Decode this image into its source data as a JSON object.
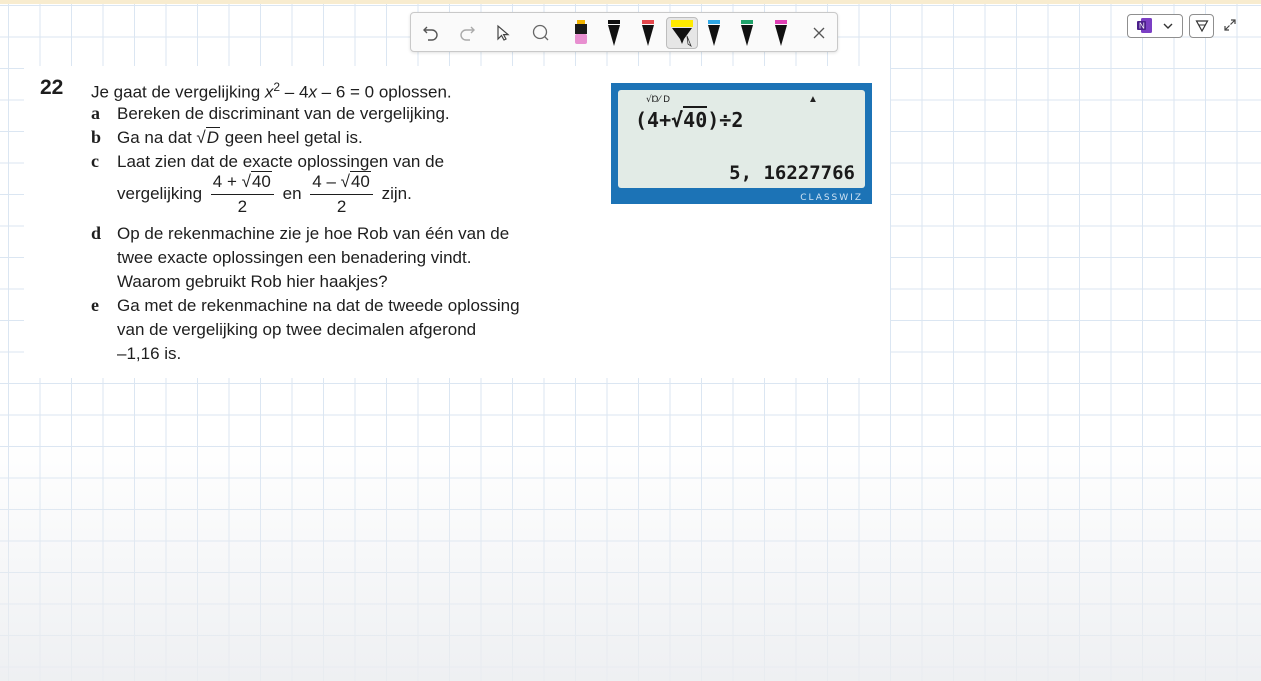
{
  "toolbar": {
    "undo_icon": "undo-icon",
    "redo_icon": "redo-icon",
    "select_icon": "pointer-icon",
    "lasso_icon": "lasso-icon",
    "pens": [
      {
        "name": "eraser-pen",
        "color": "#e88fd0"
      },
      {
        "name": "black-pen",
        "color": "#111111"
      },
      {
        "name": "red-pen",
        "color": "#e5484d"
      },
      {
        "name": "yellow-highlighter",
        "color": "#ffeb00"
      },
      {
        "name": "blue-pen",
        "color": "#2fa7e5"
      },
      {
        "name": "green-pen",
        "color": "#20a36b"
      },
      {
        "name": "magenta-pen",
        "color": "#e040b5"
      }
    ],
    "close_icon": "close-icon"
  },
  "controls": {
    "app_icon": "onenote-icon",
    "dropdown_icon": "chevron-down-icon",
    "filter_icon": "filter-icon",
    "expand_icon": "expand-icon"
  },
  "exercise": {
    "number": "22",
    "intro_pre": "Je gaat de vergelijking ",
    "intro_x": "x",
    "intro_exp": "2",
    "intro_mid": " – 4",
    "intro_x2": "x",
    "intro_post": " – 6 = 0 oplossen.",
    "a_label": "a",
    "a_text": "Bereken de discriminant van de vergelijking.",
    "b_label": "b",
    "b_pre": "Ga na dat ",
    "b_root": "√",
    "b_var": "D",
    "b_post": " geen heel getal is.",
    "c_label": "c",
    "c_text1": "Laat zien dat de exacte oplossingen van de",
    "c_pre": "vergelijking",
    "frac1_num_pre": "4 + √",
    "frac1_num_rad": "40",
    "frac1_den": "2",
    "c_en": "en",
    "frac2_num_pre": "4 – √",
    "frac2_num_rad": "40",
    "frac2_den": "2",
    "c_post": "zijn.",
    "d_label": "d",
    "d_line1": "Op de rekenmachine zie je hoe Rob van één van de",
    "d_line2": "twee exacte oplossingen een benadering vindt.",
    "d_line3": "Waarom gebruikt Rob hier haakjes?",
    "e_label": "e",
    "e_line1": "Ga met de rekenmachine na dat de tweede oplossing",
    "e_line2": "van de vergelijking op twee decimalen afgerond",
    "e_line3": "–1,16 is."
  },
  "calculator": {
    "indicators": "√Ɒ⁄ D",
    "arrow": "▲",
    "expr_pre": "(4+√",
    "expr_rad": "40",
    "expr_post": ")÷2",
    "result": "5, 16227766",
    "brand": "CLASSWIZ"
  }
}
